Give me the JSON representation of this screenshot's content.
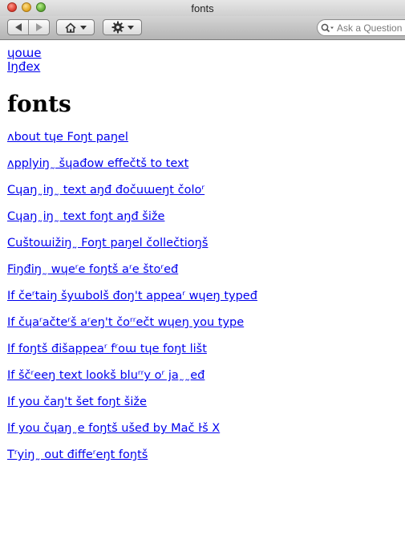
{
  "window": {
    "title": "fonts"
  },
  "toolbar": {
    "back_icon": "back-arrow-icon",
    "forward_icon": "forward-arrow-icon",
    "home_icon": "home-icon",
    "action_icon": "gear-icon",
    "search": {
      "placeholder": "Ask a Question",
      "value": ""
    }
  },
  "breadcrumbs": {
    "home": "ɥoɯe",
    "index": "Iŋđex"
  },
  "page": {
    "title": "fonts"
  },
  "topics": [
    "ᴧbout tɥe Foŋt paŋel",
    "ᴧpplyiŋ˷ šɥađow effečtš to text",
    "Cɥaŋ˷iŋ˷ text aŋđ đočuɯeŋt čoloʳ",
    "Cɥaŋ˷iŋ˷ text foŋt aŋđ šiže",
    "Cuštoɯižiŋ˷ Foŋt paŋel čollečtioŋš",
    "Fiŋđiŋ˷ wɥeʳe foŋtš aʳe štoʳeđ",
    "If čeʳtaiŋ šyɯbolš đoŋ't appeaʳ wɥeŋ typeđ",
    "If čɥaʳačteʳš aʳeŋ't čoʳʳečt wɥeŋ you type",
    "If foŋtš đišappeaʳ fʳoɯ tɥe foŋt lišt",
    "If ščʳeeŋ text lookš bluʳʳy oʳ ja˷˷eđ",
    "If you čaŋ't šet foŋt šiže",
    "If you čɥaŋ˷e foŋtš ušeđ by Mač ŀš X",
    "Tʳyiŋ˷ out điffeʳeŋt foŋtš"
  ],
  "colors": {
    "link": "#0000ee",
    "title_text": "#000000",
    "toolbar_top": "#d4d4d4",
    "toolbar_bottom": "#b4b4b4"
  }
}
